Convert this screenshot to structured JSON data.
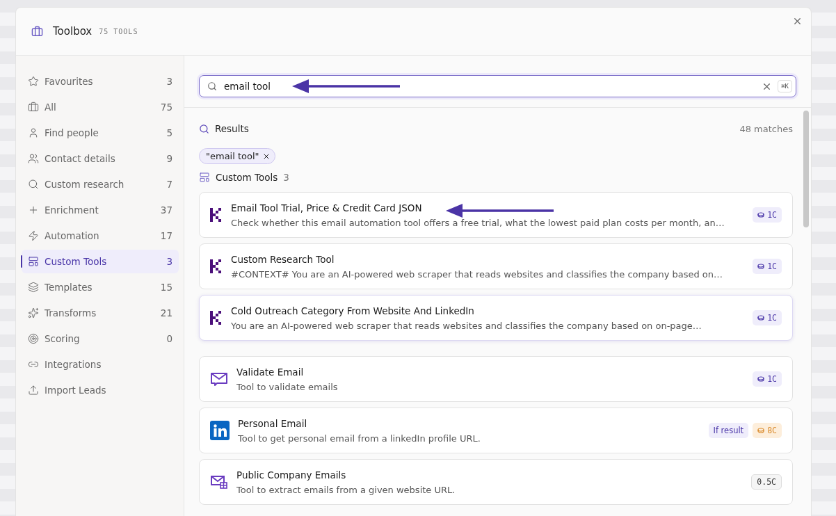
{
  "window": {
    "title": "Toolbox",
    "subtitle": "75 TOOLS"
  },
  "sidebar": {
    "items": [
      {
        "label": "Favourites",
        "count": "3",
        "selected": false
      },
      {
        "label": "All",
        "count": "75",
        "selected": false
      },
      {
        "label": "Find people",
        "count": "5",
        "selected": false
      },
      {
        "label": "Contact details",
        "count": "9",
        "selected": false
      },
      {
        "label": "Custom research",
        "count": "7",
        "selected": false
      },
      {
        "label": "Enrichment",
        "count": "37",
        "selected": false
      },
      {
        "label": "Automation",
        "count": "17",
        "selected": false
      },
      {
        "label": "Custom Tools",
        "count": "3",
        "selected": true
      },
      {
        "label": "Templates",
        "count": "15",
        "selected": false
      },
      {
        "label": "Transforms",
        "count": "21",
        "selected": false
      },
      {
        "label": "Scoring",
        "count": "0",
        "selected": false
      },
      {
        "label": "Integrations",
        "selected": false
      },
      {
        "label": "Import Leads",
        "selected": false
      }
    ]
  },
  "search": {
    "value": "email tool",
    "shortcut": "⌘K"
  },
  "results": {
    "title": "Results",
    "matches": "48 matches",
    "filters": [
      "\"email tool\""
    ],
    "groups": [
      {
        "title": "Custom Tools",
        "count": "3",
        "tools": [
          {
            "kind": "custom",
            "name": "Email Tool Trial, Price & Credit Card JSON",
            "description": "Check whether this email automation tool offers a free trial, what the lowest paid plan costs per month, an…",
            "hovered": false,
            "badges": [
              {
                "kind": "credits",
                "text": "1C"
              }
            ]
          },
          {
            "kind": "custom",
            "name": "Custom Research Tool",
            "description": "#CONTEXT# You are an AI-powered web scraper that reads websites and classifies the company based on…",
            "hovered": false,
            "badges": [
              {
                "kind": "credits",
                "text": "1C"
              }
            ]
          },
          {
            "kind": "custom",
            "name": "Cold Outreach Category From Website And LinkedIn",
            "description": "You are an AI-powered web scraper that reads websites and classifies the company based on on-page…",
            "hovered": true,
            "badges": [
              {
                "kind": "credits",
                "text": "1C"
              }
            ]
          }
        ]
      },
      {
        "tools": [
          {
            "kind": "validator",
            "name": "Validate Email",
            "description": "Tool to validate emails",
            "hovered": false,
            "badges": [
              {
                "kind": "credits",
                "text": "1C"
              }
            ]
          },
          {
            "kind": "linkedin",
            "name": "Personal Email",
            "description": "Tool to get personal email from a linkedIn profile URL.",
            "hovered": false,
            "badges": [
              {
                "kind": "note",
                "text": "If result"
              },
              {
                "kind": "credits-high",
                "text": "8C"
              }
            ]
          },
          {
            "kind": "extractor",
            "name": "Public Company Emails",
            "description": "Tool to extract emails from a given website URL.",
            "hovered": false,
            "badges": [
              {
                "kind": "plain",
                "text": "0.5C"
              }
            ]
          }
        ]
      }
    ]
  }
}
